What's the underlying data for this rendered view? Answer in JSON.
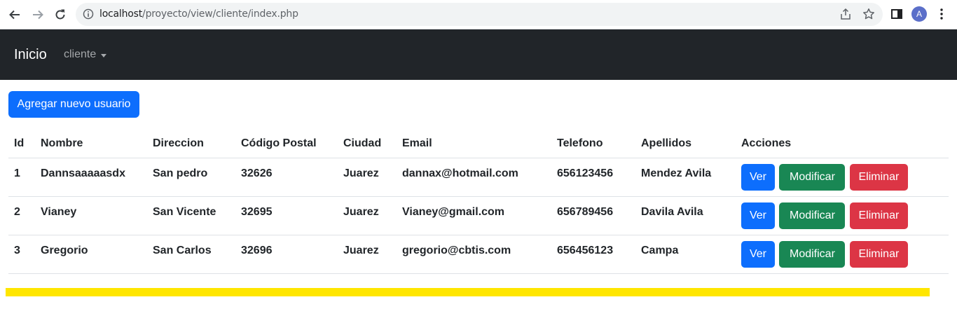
{
  "browser": {
    "url_host": "localhost",
    "url_path": "/proyecto/view/cliente/index.php",
    "profile_initial": "A",
    "icons": [
      "back-icon",
      "forward-icon",
      "reload-icon",
      "info-icon",
      "share-icon",
      "star-icon",
      "side-panel-icon",
      "menu-icon"
    ]
  },
  "navbar": {
    "brand": "Inicio",
    "dropdown_label": "cliente"
  },
  "add_button": "Agregar nuevo usuario",
  "table": {
    "headers": [
      "Id",
      "Nombre",
      "Direccion",
      "Código Postal",
      "Ciudad",
      "Email",
      "Telefono",
      "Apellidos",
      "Acciones"
    ],
    "rows": [
      {
        "id": "1",
        "nombre": "Dannsaaaaasdx",
        "direccion": "San pedro",
        "cp": "32626",
        "ciudad": "Juarez",
        "email": "dannax@hotmail.com",
        "telefono": "656123456",
        "apellidos": "Mendez Avila"
      },
      {
        "id": "2",
        "nombre": "Vianey",
        "direccion": "San Vicente",
        "cp": "32695",
        "ciudad": "Juarez",
        "email": "Vianey@gmail.com",
        "telefono": "656789456",
        "apellidos": "Davila Avila"
      },
      {
        "id": "3",
        "nombre": "Gregorio",
        "direccion": "San Carlos",
        "cp": "32696",
        "ciudad": "Juarez",
        "email": "gregorio@cbtis.com",
        "telefono": "656456123",
        "apellidos": "Campa"
      }
    ],
    "actions": {
      "ver": "Ver",
      "modificar": "Modificar",
      "eliminar": "Eliminar"
    }
  },
  "colors": {
    "primary": "#0d6efd",
    "success": "#198754",
    "danger": "#dc3545",
    "navbar": "#212529",
    "accent_bar": "#ffe600"
  }
}
